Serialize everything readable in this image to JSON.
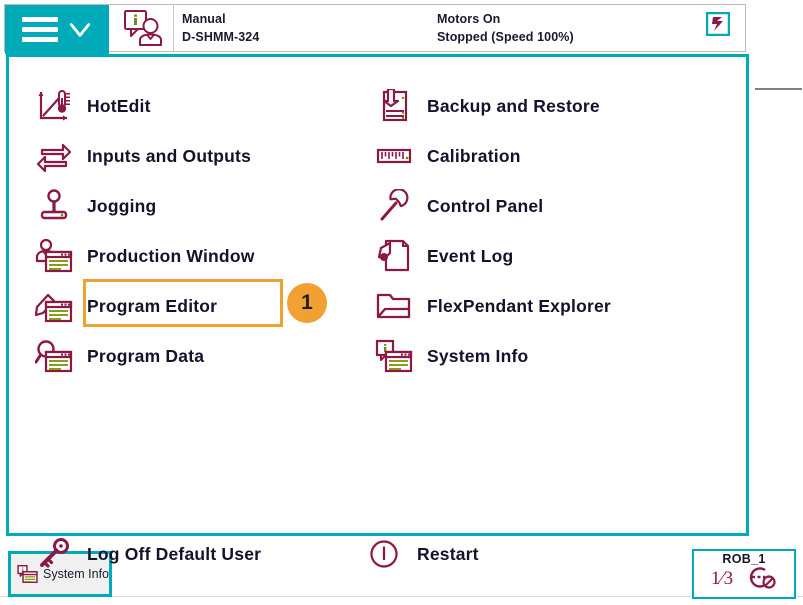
{
  "header": {
    "menu_button": {
      "name": "main-menu-button",
      "burger_icon": "hamburger-icon",
      "chevron_icon": "chevron-down-icon"
    },
    "user_icon": "operator-info-icon",
    "mode": {
      "line1": "Manual",
      "line2": "D-SHMM-324"
    },
    "motors": {
      "line1": "Motors On",
      "line2": "Stopped (Speed 100%)"
    },
    "motors_icon": "motors-status-icon"
  },
  "menu": {
    "left_items": [
      {
        "label": "HotEdit",
        "icon": "hotedit-icon"
      },
      {
        "label": "Inputs and Outputs",
        "icon": "inputs-outputs-icon"
      },
      {
        "label": "Jogging",
        "icon": "joystick-icon"
      },
      {
        "label": "Production Window",
        "icon": "production-window-icon"
      },
      {
        "label": "Program Editor",
        "icon": "program-editor-icon"
      },
      {
        "label": "Program Data",
        "icon": "program-data-icon"
      }
    ],
    "right_items": [
      {
        "label": "Backup and Restore",
        "icon": "backup-restore-icon"
      },
      {
        "label": "Calibration",
        "icon": "calibration-ruler-icon"
      },
      {
        "label": "Control Panel",
        "icon": "wrench-icon"
      },
      {
        "label": "Event Log",
        "icon": "event-log-icon"
      },
      {
        "label": "FlexPendant Explorer",
        "icon": "folder-icon"
      },
      {
        "label": "System Info",
        "icon": "system-info-icon"
      }
    ],
    "bottom_items": [
      {
        "label": "Log Off Default User",
        "icon": "key-icon"
      },
      {
        "label": "Restart",
        "icon": "power-restart-icon"
      }
    ]
  },
  "annotation": {
    "badge_number": "1",
    "target": "Program Editor",
    "highlight_color": "#f0a132"
  },
  "taskbar": {
    "task_button": {
      "label": "System Info",
      "icon": "system-info-icon"
    },
    "quickset": {
      "title": "ROB_1",
      "fraction": "1⁄3",
      "increment_icon": "quickset-increment-icon"
    }
  },
  "colors": {
    "accent_teal": "#00aab9",
    "icon_maroon": "#8c1845",
    "text_dark": "#13132b",
    "highlight_orange": "#f0a132"
  }
}
